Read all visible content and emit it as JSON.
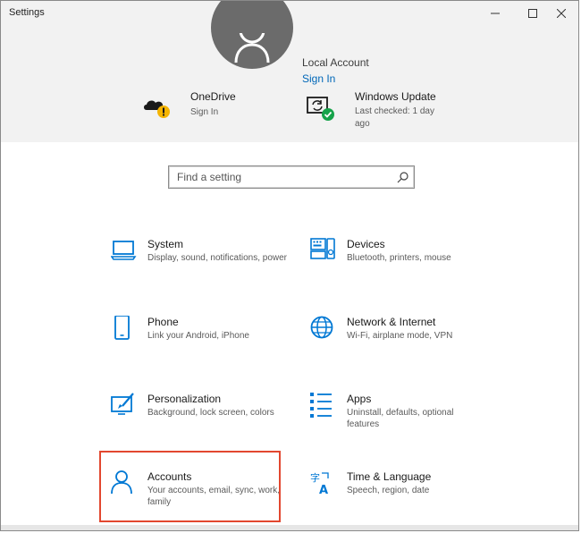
{
  "window": {
    "title": "Settings"
  },
  "header": {
    "account_type": "Local Account",
    "sign_in_link": "Sign In",
    "items": [
      {
        "name": "onedrive",
        "title": "OneDrive",
        "subtitle": "Sign In",
        "icon": "onedrive-warning-icon",
        "status_color": "#f5b400"
      },
      {
        "name": "windows-update",
        "title": "Windows Update",
        "subtitle": "Last checked: 1 day ago",
        "icon": "windows-update-icon",
        "status_color": "#16a34a"
      }
    ]
  },
  "search": {
    "placeholder": "Find a setting",
    "value": "",
    "icon": "search-icon"
  },
  "categories": [
    {
      "title": "System",
      "description": "Display, sound, notifications, power",
      "icon": "laptop-icon"
    },
    {
      "title": "Devices",
      "description": "Bluetooth, printers, mouse",
      "icon": "keyboard-devices-icon"
    },
    {
      "title": "Phone",
      "description": "Link your Android, iPhone",
      "icon": "phone-icon"
    },
    {
      "title": "Network & Internet",
      "description": "Wi-Fi, airplane mode, VPN",
      "icon": "globe-icon"
    },
    {
      "title": "Personalization",
      "description": "Background, lock screen, colors",
      "icon": "paint-brush-icon"
    },
    {
      "title": "Apps",
      "description": "Uninstall, defaults, optional features",
      "icon": "apps-list-icon"
    },
    {
      "title": "Accounts",
      "description": "Your accounts, email, sync, work, family",
      "icon": "person-icon"
    },
    {
      "title": "Time & Language",
      "description": "Speech, region, date",
      "icon": "time-language-icon"
    }
  ],
  "colors": {
    "accent": "#0067b8",
    "icon_blue": "#0078d4",
    "header_bg": "#f2f2f2",
    "highlight_border": "#e2472f"
  }
}
